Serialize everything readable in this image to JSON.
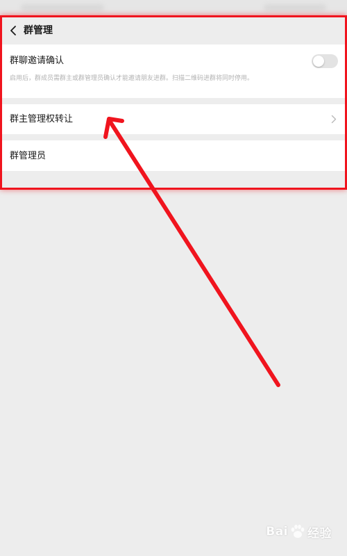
{
  "nav": {
    "title": "群管理"
  },
  "settings": {
    "invite_confirm": {
      "label": "群聊邀请确认",
      "description": "启用后，群成员需群主或群管理员确认才能邀请朋友进群。扫描二维码进群将同时停用。",
      "enabled": false
    },
    "transfer_owner": {
      "label": "群主管理权转让"
    },
    "admins": {
      "label": "群管理员"
    }
  },
  "watermark": {
    "text_left": "Bai",
    "text_right": "经验"
  },
  "icons": {
    "back": "chevron-left-icon",
    "row_arrow": "chevron-right-icon",
    "watermark": "paw-icon"
  },
  "colors": {
    "page_background": "#ededed",
    "annotation_red": "#f0141e",
    "toggle_off": "#e3e3e3",
    "secondary_text": "#b3b3b3"
  }
}
